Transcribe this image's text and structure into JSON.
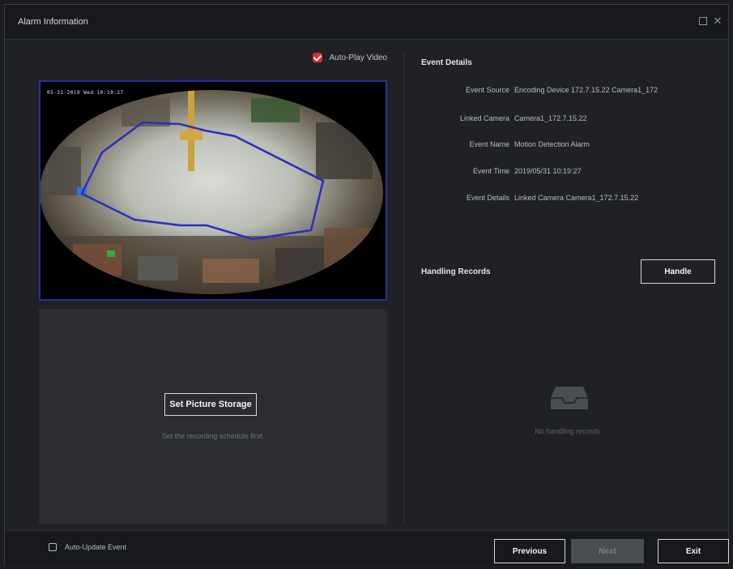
{
  "window": {
    "title": "Alarm Information"
  },
  "left": {
    "autoplay_label": "Auto-Play Video",
    "video_osd": "05-31-2019 Wed 10:19:27",
    "storage_button": "Set Picture Storage",
    "storage_hint": "Set the recording schedule first."
  },
  "details": {
    "section_title": "Event Details",
    "rows": [
      {
        "label": "Event Source",
        "value": "Encoding Device 172.7.15.22 Camera1_172"
      },
      {
        "label": "Linked Camera",
        "value": "Camera1_172.7.15.22"
      },
      {
        "label": "Event Name",
        "value": "Motion Detection Alarm"
      },
      {
        "label": "Event Time",
        "value": "2019/05/31 10:19:27"
      },
      {
        "label": "Event Details",
        "value": "Linked Camera Camera1_172.7.15.22"
      }
    ]
  },
  "handling": {
    "section_title": "Handling Records",
    "handle_button": "Handle",
    "empty_text": "No handling records"
  },
  "footer": {
    "auto_update_label": "Auto-Update Event",
    "previous": "Previous",
    "next": "Next",
    "exit": "Exit"
  },
  "icons": {
    "maximize": "maximize-icon",
    "close": "close-icon",
    "empty": "empty-tray-icon"
  },
  "colors": {
    "accent_red": "#e5252b",
    "roi_blue": "#2a2fc0",
    "window_bg": "#1f2125"
  }
}
